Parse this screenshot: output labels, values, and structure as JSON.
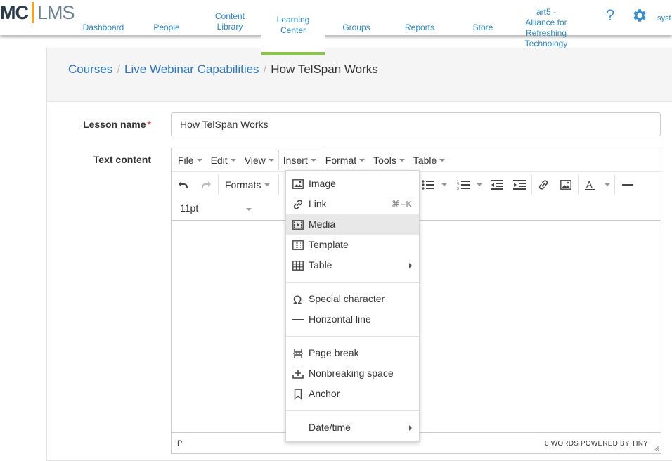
{
  "nav": {
    "logo_mc": "MC",
    "logo_lms": "LMS",
    "items": [
      {
        "label": "Dashboard"
      },
      {
        "label": "People"
      },
      {
        "label": "Content Library"
      },
      {
        "label": "Learning Center"
      },
      {
        "label": "Groups"
      },
      {
        "label": "Reports"
      },
      {
        "label": "Store"
      },
      {
        "label": "art5 - Alliance for Refreshing Technology"
      }
    ],
    "help": "?",
    "user": "syst"
  },
  "breadcrumb": {
    "items": [
      "Courses",
      "Live Webinar Capabilities"
    ],
    "current": "How TelSpan Works",
    "separator": "/"
  },
  "form": {
    "lesson_label": "Lesson name",
    "required_mark": "*",
    "lesson_value": "How TelSpan Works",
    "text_label": "Text content"
  },
  "editor": {
    "menus": [
      "File",
      "Edit",
      "View",
      "Insert",
      "Format",
      "Tools",
      "Table"
    ],
    "formats_label": "Formats",
    "font_size": "11pt",
    "status_path": "P",
    "status_words": "0 WORDS POWERED BY TINY"
  },
  "insert_menu": {
    "items": [
      {
        "label": "Image",
        "icon": "image-icon"
      },
      {
        "label": "Link",
        "icon": "link-icon",
        "shortcut": "⌘+K"
      },
      {
        "label": "Media",
        "icon": "media-icon"
      },
      {
        "label": "Template",
        "icon": "template-icon"
      },
      {
        "label": "Table",
        "icon": "table-icon"
      },
      {
        "label": "Special character",
        "icon": "omega-icon"
      },
      {
        "label": "Horizontal line",
        "icon": "hr-icon"
      },
      {
        "label": "Page break",
        "icon": "page-break-icon"
      },
      {
        "label": "Nonbreaking space",
        "icon": "nbsp-icon"
      },
      {
        "label": "Anchor",
        "icon": "bookmark-icon"
      },
      {
        "label": "Date/time"
      }
    ],
    "highlighted": "Media"
  },
  "colors": {
    "link": "#2c87c6",
    "active_underline": "#8bc34a",
    "logo_accent": "#f2a41b"
  }
}
